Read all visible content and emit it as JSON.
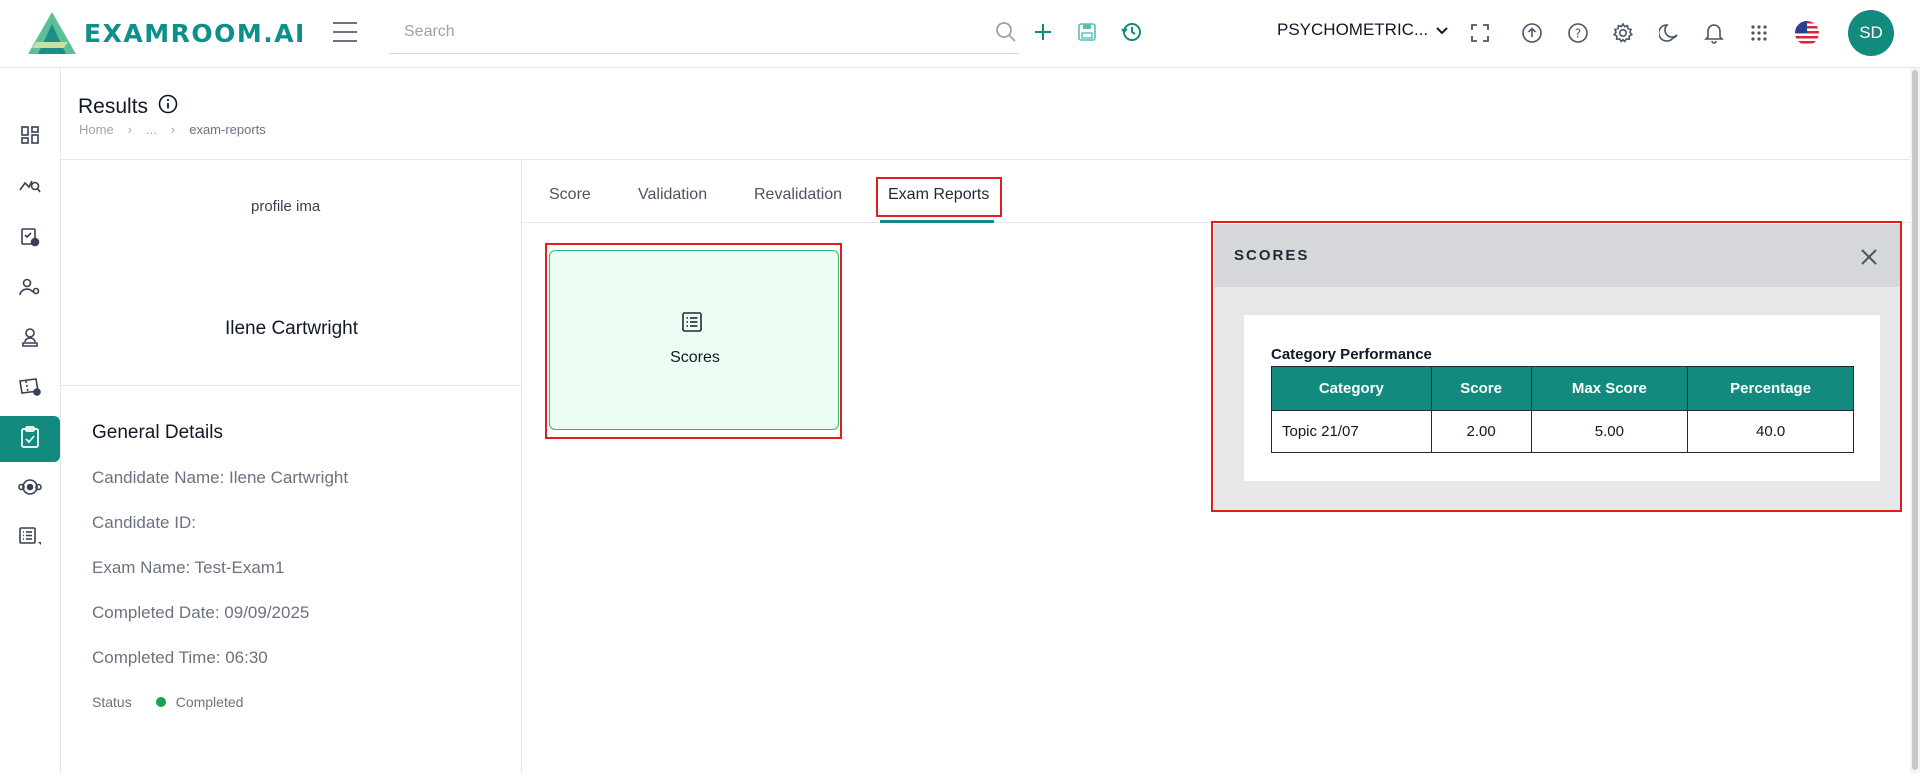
{
  "brand": {
    "logo_text": "EXAMROOM.AI",
    "accent": "#138a7e"
  },
  "header": {
    "search_placeholder": "Search",
    "exam_selector": "PSYCHOMETRIC...",
    "avatar_initials": "SD"
  },
  "page": {
    "title": "Results",
    "breadcrumb": {
      "home": "Home",
      "ellipsis": "...",
      "current": "exam-reports"
    }
  },
  "candidate": {
    "profile_image_alt": "profile ima",
    "name": "Ilene Cartwright"
  },
  "general_details": {
    "title": "General Details",
    "candidate_name": "Candidate Name: Ilene Cartwright",
    "candidate_id": "Candidate ID:",
    "exam_name": "Exam Name: Test-Exam1",
    "completed_date": "Completed Date: 09/09/2025",
    "completed_time": "Completed Time: 06:30",
    "status_label": "Status",
    "status_value": "Completed",
    "status_color": "#16a34a"
  },
  "tabs": [
    "Score",
    "Validation",
    "Revalidation",
    "Exam Reports"
  ],
  "report_card": {
    "label": "Scores"
  },
  "scores_modal": {
    "title": "SCORES",
    "section_title": "Category Performance",
    "headers": [
      "Category",
      "Score",
      "Max Score",
      "Percentage"
    ],
    "rows": [
      [
        "Topic 21/07",
        "2.00",
        "5.00",
        "40.0"
      ]
    ]
  }
}
